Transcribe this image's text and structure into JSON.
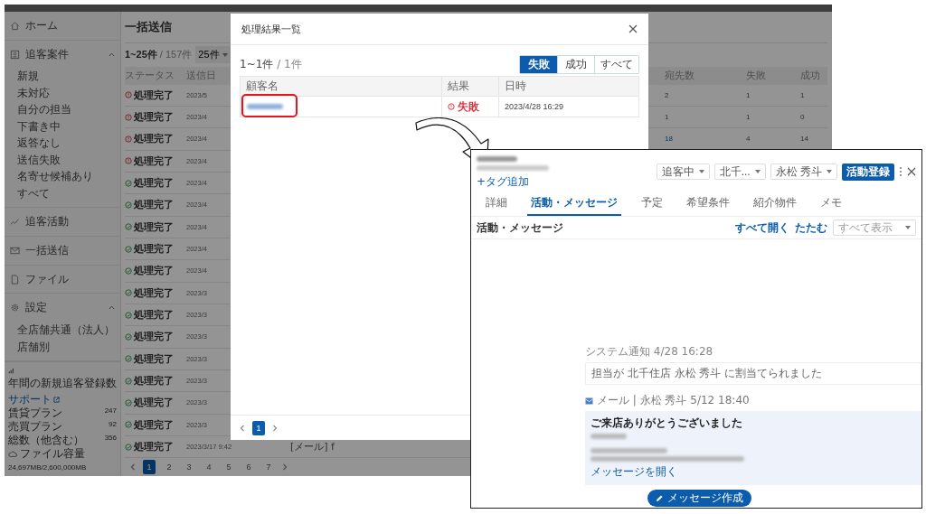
{
  "sidebar": {
    "items": [
      {
        "kind": "link",
        "label": "ホーム"
      },
      {
        "kind": "group",
        "label": "追客案件",
        "expanded": true,
        "children": [
          {
            "label": "新規"
          },
          {
            "label": "未対応"
          },
          {
            "label": "自分の担当"
          },
          {
            "label": "下書き中"
          },
          {
            "label": "返答なし"
          },
          {
            "label": "送信失敗"
          },
          {
            "label": "名寄せ候補あり"
          },
          {
            "label": "すべて"
          }
        ]
      },
      {
        "kind": "link",
        "label": "追客活動"
      },
      {
        "kind": "link",
        "label": "一括送信"
      },
      {
        "kind": "link",
        "label": "ファイル"
      },
      {
        "kind": "group",
        "label": "設定",
        "expanded": true,
        "children": [
          {
            "label": "全店舗共通（法人）"
          },
          {
            "label": "店舗別"
          }
        ]
      }
    ],
    "stats": {
      "title": "年間の新規追客登録数",
      "support": "サポート",
      "rows": [
        {
          "label": "賃貸プラン",
          "value": "247"
        },
        {
          "label": "売買プラン",
          "value": "92"
        },
        {
          "label": "総数（他含む）",
          "value": "356"
        }
      ],
      "storage_label": "ファイル容量",
      "storage_value": "24,697MB/2,600,000MB"
    }
  },
  "main": {
    "title": "一括送信",
    "count": "1~25件",
    "total": "/ 157件",
    "page_size": "25件",
    "columns": [
      "ステータス",
      "送信日",
      "宛先数",
      "失敗",
      "成功"
    ],
    "rows": [
      {
        "kind": "error",
        "status": "処理完了",
        "date": "2023/5",
        "recipients": "2",
        "recipients_linked": false,
        "failed": "1",
        "succeeded": "1"
      },
      {
        "kind": "error",
        "status": "処理完了",
        "date": "2023/4",
        "recipients": "1",
        "recipients_linked": false,
        "failed": "1",
        "succeeded": "0"
      },
      {
        "kind": "error",
        "status": "処理完了",
        "date": "2023/4",
        "recipients": "18",
        "recipients_linked": true,
        "failed": "4",
        "succeeded": "14"
      },
      {
        "kind": "error",
        "status": "処理完了",
        "date": "2023/4"
      },
      {
        "kind": "success",
        "status": "処理完了",
        "date": "2023/4"
      },
      {
        "kind": "success",
        "status": "処理完了",
        "date": "2023/4"
      },
      {
        "kind": "success",
        "status": "処理完了",
        "date": "2023/4"
      },
      {
        "kind": "success",
        "status": "処理完了",
        "date": "2023/4"
      },
      {
        "kind": "success",
        "status": "処理完了",
        "date": "2023/4"
      },
      {
        "kind": "success",
        "status": "処理完了",
        "date": "2023/3"
      },
      {
        "kind": "success",
        "status": "処理完了",
        "date": "2023/3"
      },
      {
        "kind": "success",
        "status": "処理完了",
        "date": "2023/3"
      },
      {
        "kind": "success",
        "status": "処理完了",
        "date": "2023/3"
      },
      {
        "kind": "success",
        "status": "処理完了",
        "date": "2023/3"
      },
      {
        "kind": "success",
        "status": "処理完了",
        "date": "2023/3"
      },
      {
        "kind": "success",
        "status": "処理完了",
        "date": "2023/3"
      },
      {
        "kind": "success",
        "status": "処理完了",
        "date": "2023/3/17 9:42",
        "subject": "[メール] f"
      }
    ],
    "pages": [
      {
        "label": "1",
        "selected": true
      },
      {
        "label": "2",
        "selected": false
      },
      {
        "label": "3",
        "selected": false
      },
      {
        "label": "4",
        "selected": false
      },
      {
        "label": "5",
        "selected": false
      },
      {
        "label": "6",
        "selected": false
      },
      {
        "label": "7",
        "selected": false
      }
    ]
  },
  "modal": {
    "title": "処理結果一覧",
    "count": "1~1件",
    "total": "/ 1件",
    "filters": [
      {
        "label": "失敗",
        "selected": true
      },
      {
        "label": "成功",
        "selected": false
      },
      {
        "label": "すべて",
        "selected": false
      }
    ],
    "columns": [
      "顧客名",
      "結果",
      "日時"
    ],
    "rows": [
      {
        "kind": "error",
        "result": "失敗",
        "date": "2023/4/28 16:29",
        "highlighted": true
      }
    ],
    "pages": [
      {
        "label": "1",
        "selected": true
      }
    ]
  },
  "inset": {
    "tag_link": "+タグ追加",
    "selects": [
      {
        "label": "追客中"
      },
      {
        "label": "北千..."
      },
      {
        "label": "永松 秀斗"
      }
    ],
    "action": "活動登録",
    "tabs": [
      {
        "label": "詳細",
        "selected": false
      },
      {
        "label": "活動・メッセージ",
        "selected": true
      },
      {
        "label": "予定",
        "selected": false
      },
      {
        "label": "希望条件",
        "selected": false
      },
      {
        "label": "紹介物件",
        "selected": false
      },
      {
        "label": "メモ",
        "selected": false
      }
    ],
    "section": "活動・メッセージ",
    "expand_all": "すべて開く",
    "collapse": "たたむ",
    "filter": "すべて表示",
    "notice": {
      "header": "システム通知 4/28 16:28",
      "text": "担当が 北千住店 永松 秀斗 に割当てられました"
    },
    "message": {
      "header": "メール | 永松 秀斗 5/12 18:40",
      "subject": "ご来店ありがとうございました",
      "open_link": "メッセージを開く"
    },
    "compose": "メッセージ作成"
  }
}
